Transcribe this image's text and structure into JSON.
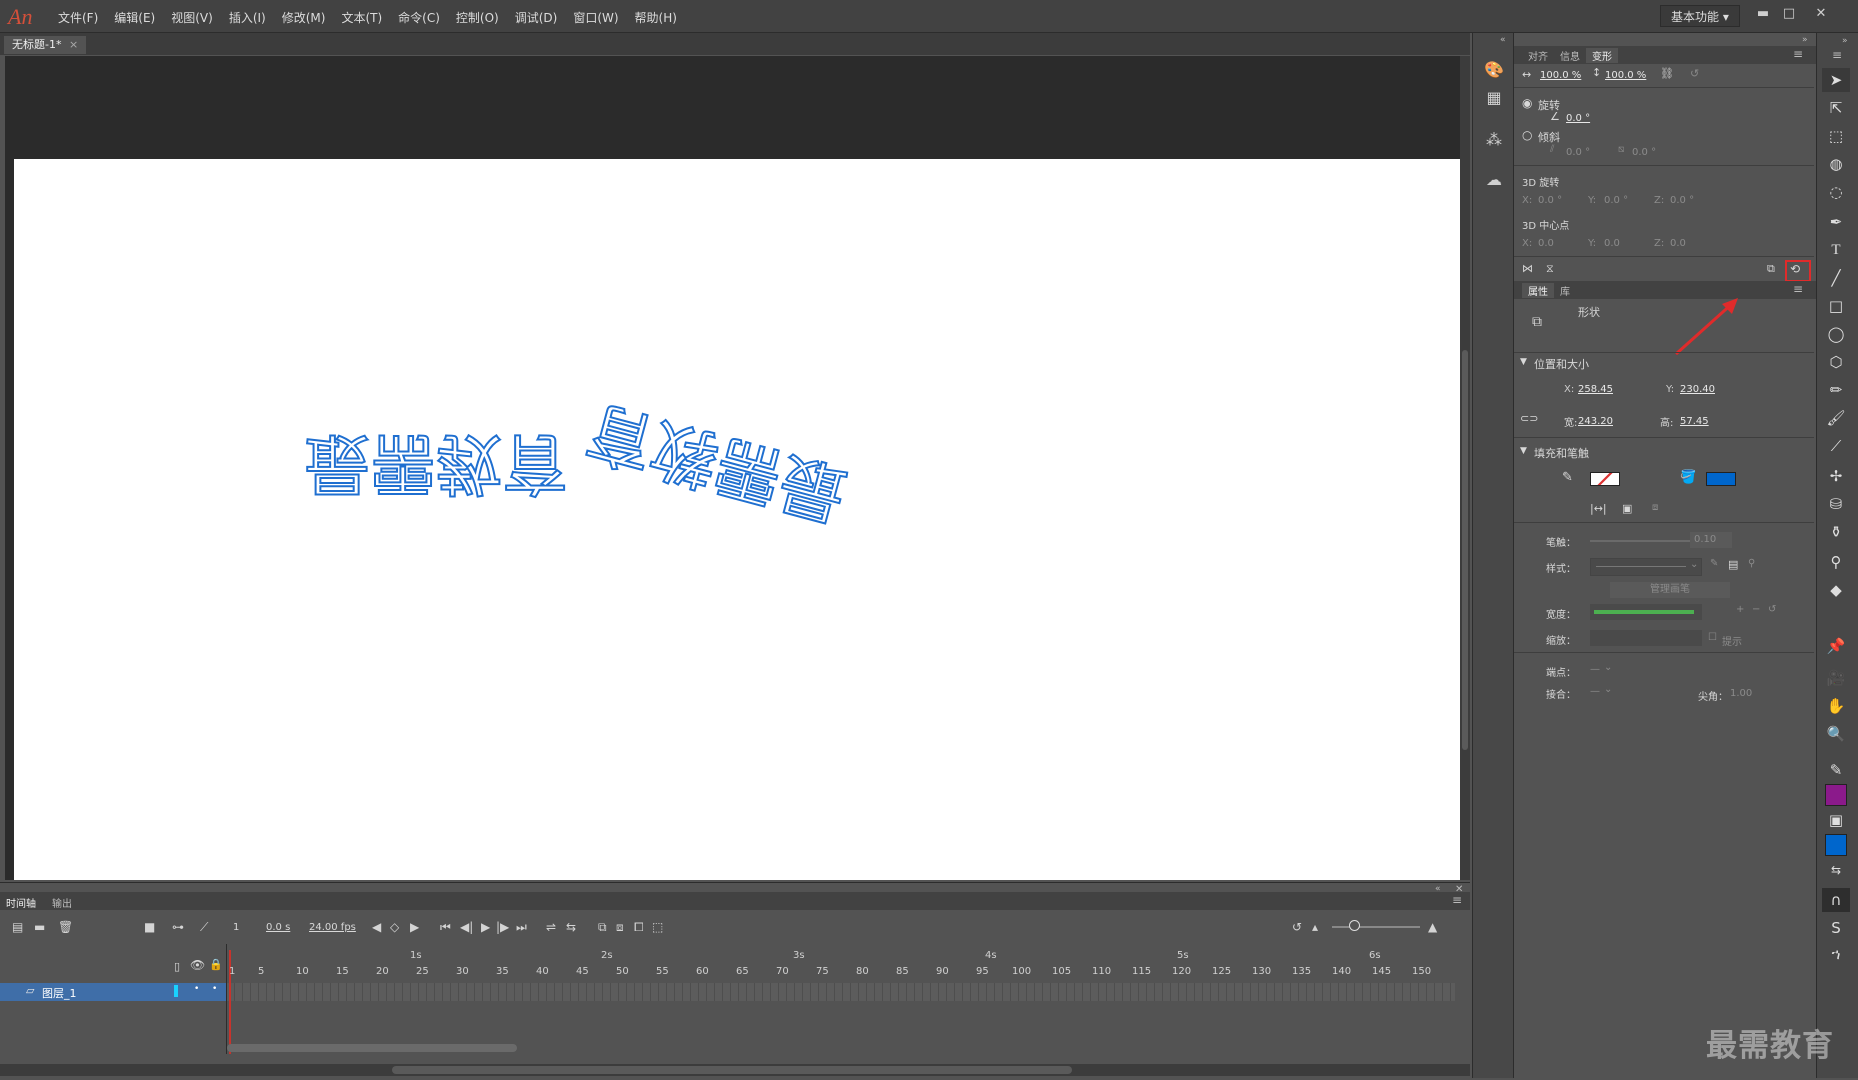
{
  "app": {
    "logo": "An"
  },
  "menu": [
    "文件(F)",
    "编辑(E)",
    "视图(V)",
    "插入(I)",
    "修改(M)",
    "文本(T)",
    "命令(C)",
    "控制(O)",
    "调试(D)",
    "窗口(W)",
    "帮助(H)"
  ],
  "workspace": "基本功能",
  "window_controls": {
    "minimize": "▬",
    "maximize": "□",
    "close": "✕"
  },
  "document_tab": {
    "title": "无标题-1*",
    "close": "×"
  },
  "stage_text": "最需教育最需教育",
  "colors": {
    "stage_text": "#1f6fd0",
    "fill": "#0066cc",
    "stroke_fill_color": "#8b1a8b",
    "accent_red": "#e02b2b"
  },
  "transform_panel": {
    "tabs": [
      "对齐",
      "信息",
      "变形"
    ],
    "active_tab": "变形",
    "scale_w": "100.0 %",
    "scale_h": "100.0 %",
    "rotate_label": "旋转",
    "rotate_value": "0.0 °",
    "skew_label": "倾斜",
    "skew_h": "0.0 °",
    "skew_v": "0.0 °",
    "rot3d_label": "3D 旋转",
    "rot3d": {
      "x": "0.0 °",
      "y": "0.0 °",
      "z": "0.0 °"
    },
    "center3d_label": "3D 中心点",
    "center3d": {
      "x": "0.0",
      "y": "0.0",
      "z": "0.0"
    },
    "axis": {
      "x": "X:",
      "y": "Y:",
      "z": "Z:"
    }
  },
  "properties_panel": {
    "tabs": [
      "属性",
      "库"
    ],
    "active_tab": "属性",
    "object_type": "形状",
    "section_position": "位置和大小",
    "x_label": "X:",
    "x": "258.45",
    "y_label": "Y:",
    "y": "230.40",
    "w_label": "宽:",
    "w": "243.20",
    "h_label": "高:",
    "h": "57.45",
    "section_fill": "填充和笔触",
    "stroke_label": "笔触：",
    "stroke_value": "0.10",
    "style_label": "样式：",
    "manage_brush": "管理画笔",
    "width_label": "宽度：",
    "scale_label": "缩放：",
    "hint_label": "提示",
    "cap_label": "端点：",
    "join_label": "接合：",
    "miter_label": "尖角：",
    "miter_value": "1.00",
    "dash": "—"
  },
  "timeline": {
    "tabs": [
      "时间轴",
      "输出"
    ],
    "active_tab": "时间轴",
    "frame": "1",
    "time": "0.0 s",
    "fps": "24.00 fps",
    "layer_name": "图层_1",
    "seconds": [
      "1s",
      "2s",
      "3s",
      "4s",
      "5s",
      "6s"
    ],
    "ticks": [
      "1",
      "5",
      "10",
      "15",
      "20",
      "25",
      "30",
      "35",
      "40",
      "45",
      "50",
      "55",
      "60",
      "65",
      "70",
      "75",
      "80",
      "85",
      "90",
      "95",
      "100",
      "105",
      "110",
      "115",
      "120",
      "125",
      "130",
      "135",
      "140",
      "145",
      "150"
    ]
  },
  "watermark": "最需教育"
}
